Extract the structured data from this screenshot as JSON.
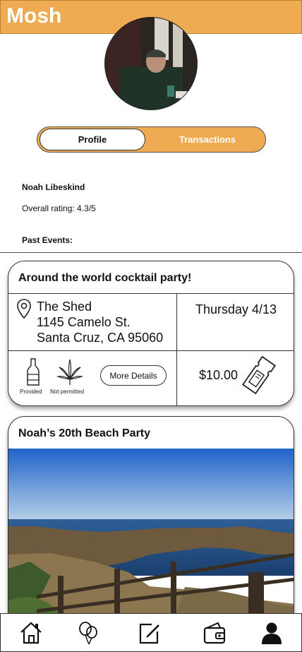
{
  "header": {
    "app_title": "Mosh"
  },
  "profile": {
    "tabs": {
      "profile": "Profile",
      "transactions": "Transactions"
    },
    "active_tab": "Profile",
    "name": "Noah Libeskind",
    "rating_text": "Overall rating: 4.3/5",
    "past_events_heading": "Past Events:"
  },
  "events": [
    {
      "title": "Around the world cocktail party!",
      "venue": "The Shed",
      "street": "1145 Camelo St.",
      "city": "Santa Cruz, CA 95060",
      "date": "Thursday 4/13",
      "alcohol_label": "Provided",
      "cannabis_label": "Not permitted",
      "details_button": "More Details",
      "price": "$10.00"
    },
    {
      "title": "Noah’s 20th Beach Party"
    }
  ],
  "bottom_nav": {
    "items": [
      "home-icon",
      "balloons-icon",
      "edit-icon",
      "wallet-icon",
      "profile-icon"
    ],
    "active": "profile-icon"
  },
  "colors": {
    "accent": "#efab52",
    "text": "#111111",
    "background": "#ffffff"
  }
}
